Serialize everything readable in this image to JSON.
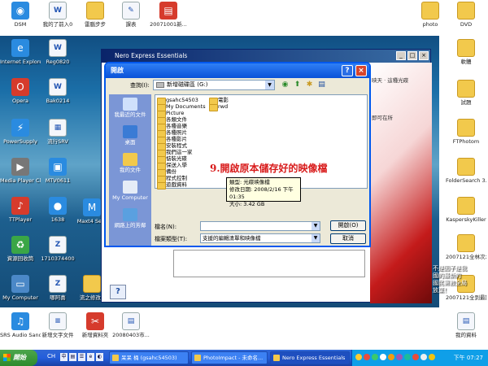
{
  "desktop": {
    "icons_left_top": [
      {
        "label": "DSM",
        "kind": "app"
      },
      {
        "label": "我的了前入0",
        "kind": "doc"
      },
      {
        "label": "雷腦步步",
        "kind": "folder"
      },
      {
        "label": "課表",
        "kind": "doc"
      },
      {
        "label": "20071001新...",
        "kind": "red"
      }
    ],
    "icons_right_top": [
      {
        "label": "photo",
        "kind": "folder"
      },
      {
        "label": "DVD",
        "kind": "folder"
      }
    ],
    "icons_left": [
      {
        "label": "Internet Explorer",
        "kind": "app"
      },
      {
        "label": "Reg0820",
        "kind": "doc"
      },
      {
        "label": "Opera",
        "kind": "red"
      },
      {
        "label": "Bak0214",
        "kind": "doc"
      },
      {
        "label": "PowerSupply",
        "kind": "app"
      },
      {
        "label": "流行SRV",
        "kind": "doc"
      },
      {
        "label": "Media Player Classic",
        "kind": "gray"
      },
      {
        "label": "MTV0611",
        "kind": "app"
      },
      {
        "label": "TTPlayer",
        "kind": "red"
      },
      {
        "label": "1638",
        "kind": "app"
      },
      {
        "label": "資源回收筒",
        "kind": "green"
      },
      {
        "label": "1710374400",
        "kind": "doc"
      },
      {
        "label": "My Computer",
        "kind": "pc"
      },
      {
        "label": "哪阿喜",
        "kind": "doc"
      }
    ],
    "icons_col3": [
      {
        "label": "Maxt4 Se...",
        "kind": "app"
      },
      {
        "label": "流之修改1",
        "kind": "folder"
      }
    ],
    "icons_right": [
      {
        "label": "軟體",
        "kind": "folder"
      },
      {
        "label": "試題",
        "kind": "folder"
      },
      {
        "label": "FTPhotom",
        "kind": "folder"
      },
      {
        "label": "FolderSearch 3.1 Preview 16",
        "kind": "folder"
      },
      {
        "label": "KasperskyKiller",
        "kind": "folder"
      },
      {
        "label": "2007121全林次水果進",
        "kind": "folder"
      },
      {
        "label": "2007121全到最期",
        "kind": "folder"
      }
    ],
    "icons_bottom": [
      {
        "label": "SRS Audio Sandbox",
        "kind": "app"
      },
      {
        "label": "新增文字文件",
        "kind": "doc"
      },
      {
        "label": "新增資料夾",
        "kind": "red"
      },
      {
        "label": "20080403市...",
        "kind": "doc"
      },
      {
        "label": "我的資料",
        "kind": "doc"
      }
    ],
    "overlay_text_right": [
      "不是因子是我",
      "國的最新的",
      "國民黨教全局",
      "放棄！"
    ]
  },
  "nero_window": {
    "title": "Nero Express Essentials",
    "side_text_1": "映天 · 這種光碟",
    "side_text_2": "即可在所"
  },
  "open_dialog": {
    "title": "開啟",
    "lookin_label": "查詢(I):",
    "lookin_value": "新增磁碟區 (G:)",
    "places": [
      "我最近的文件",
      "桌面",
      "我的文件",
      "My Computer",
      "網路上的芳鄰"
    ],
    "files_col1": [
      "gsahc54503",
      "My Documents",
      "Picture",
      "各類文件",
      "各種音樂",
      "各種照片",
      "各種影片",
      "安裝程式",
      "我們這一家",
      "惦裝光碟",
      "保送入學",
      "備份",
      "程式控制",
      "遊戲資料"
    ],
    "files_col2": [
      "電影",
      "rwd"
    ],
    "tooltip": [
      "類型: 光碟映像檔",
      "修改日期: 2008/2/16 下午 01:35",
      "大小: 3.42 GB"
    ],
    "caption": "9.開啟原本儲存好的映像檔",
    "filename_label": "檔名(N):",
    "filename_value": "",
    "filetype_label": "檔案類型(T):",
    "filetype_value": "支援的編輯清單和映像檔",
    "open_button": "開啟(O)",
    "cancel_button": "取消"
  },
  "taskbar": {
    "start_label": "開始",
    "lang": "CH",
    "tasks": [
      "呆呆 桶 (gsahc54503)",
      "PhotoImpact - 未命名...",
      "Nero Express Essentials"
    ],
    "clock": "下午 07:27"
  }
}
